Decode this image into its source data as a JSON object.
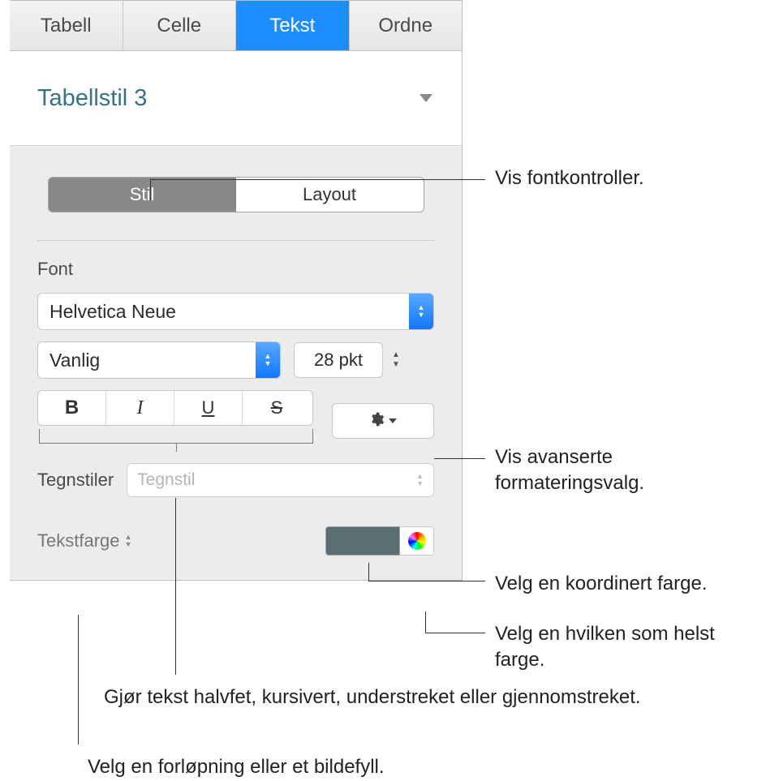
{
  "tabs": {
    "tabell": "Tabell",
    "celle": "Celle",
    "tekst": "Tekst",
    "ordne": "Ordne"
  },
  "style_picker": {
    "name": "Tabellstil 3"
  },
  "segmented": {
    "stil": "Stil",
    "layout": "Layout"
  },
  "font": {
    "section_label": "Font",
    "family": "Helvetica Neue",
    "weight": "Vanlig",
    "size": "28 pkt"
  },
  "character_styles": {
    "label": "Tegnstiler",
    "placeholder": "Tegnstil"
  },
  "text_color": {
    "label": "Tekstfarge",
    "swatch_hex": "#5b6e72"
  },
  "callouts": {
    "font_controls": "Vis fontkontroller.",
    "advanced": "Vis avanserte formateringsvalg.",
    "coord_color": "Velg en koordinert farge.",
    "any_color": "Velg en hvilken som helst farge.",
    "bius": "Gjør tekst halvfet, kursivert, understreket eller gjennomstreket.",
    "gradient": "Velg en forløpning eller et bildefyll."
  }
}
